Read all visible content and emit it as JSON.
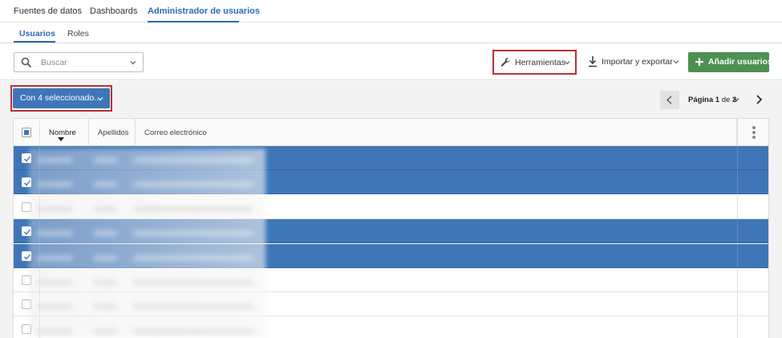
{
  "nav": {
    "tabs": [
      {
        "label": "Fuentes de datos"
      },
      {
        "label": "Dashboards"
      },
      {
        "label": "Administrador de usuarios",
        "active": true
      }
    ]
  },
  "subnav": {
    "tabs": [
      {
        "label": "Usuarios",
        "active": true
      },
      {
        "label": "Roles"
      }
    ]
  },
  "toolbar": {
    "search": {
      "placeholder": "Buscar",
      "icon": "search-icon"
    },
    "tools_label": "Herramientas",
    "tools_icon": "wrench-icon",
    "export_label": "Importar y exportar",
    "export_icon": "download-icon",
    "add_label": "Añadir usuarios",
    "add_icon": "plus-icon"
  },
  "selection": {
    "label": "Con 4 seleccionado..."
  },
  "pagination": {
    "prefix": "Página",
    "current": "1",
    "separator": "de",
    "total": "2"
  },
  "table": {
    "columns": [
      {
        "label": "Nombre",
        "sorted": "desc"
      },
      {
        "label": "Apellidos"
      },
      {
        "label": "Correo electrónico"
      }
    ],
    "rows": [
      {
        "checked": true
      },
      {
        "checked": true
      },
      {
        "checked": false
      },
      {
        "checked": true
      },
      {
        "checked": true
      },
      {
        "checked": false
      },
      {
        "checked": false
      },
      {
        "checked": false
      }
    ]
  },
  "colors": {
    "accent": "#2f6ab2",
    "selected_row": "#3f76b8",
    "add_button": "#4d9152",
    "highlight_border": "#b83232"
  }
}
